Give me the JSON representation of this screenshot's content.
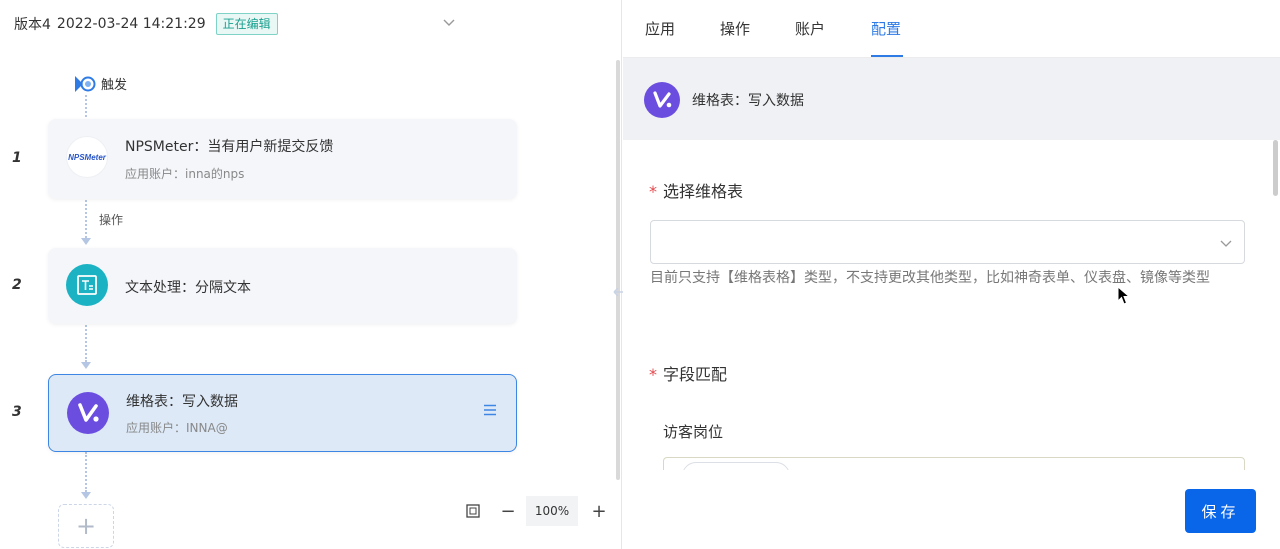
{
  "version": {
    "label": "版本4",
    "timestamp": "2022-03-24 14:21:29",
    "status": "正在编辑"
  },
  "flow": {
    "trigger_label": "触发",
    "operation_label": "操作",
    "steps": [
      {
        "number": "1",
        "title": "NPSMeter：当有用户新提交反馈",
        "subtitle": "应用账户：inna的nps",
        "logo_text": "NPSMeter"
      },
      {
        "number": "2",
        "title": "文本处理：分隔文本",
        "subtitle": ""
      },
      {
        "number": "3",
        "title": "维格表：写入数据",
        "subtitle": "应用账户：INNA@"
      }
    ],
    "add_symbol": "+"
  },
  "zoom": {
    "minus": "−",
    "value": "100%",
    "plus": "+"
  },
  "tabs": [
    {
      "label": "应用"
    },
    {
      "label": "操作"
    },
    {
      "label": "账户"
    },
    {
      "label": "配置",
      "active": true
    }
  ],
  "config": {
    "app_title": "维格表：写入数据",
    "select_sheet_label": "选择维格表",
    "select_sheet_value": "",
    "hint": "目前只支持【维格表格】类型，不支持更改其他类型，比如神奇表单、仪表盘、镜像等类型",
    "field_match_label": "字段匹配",
    "field_name": "访客岗位",
    "required_mark": "*",
    "save_label": "保存"
  },
  "colors": {
    "accent": "#2f7be5",
    "save_button": "#0a66e8",
    "badge_text": "#1aa08f",
    "vika_logo": "#6b4ee0",
    "text_tool": "#1bb3c4",
    "required": "#e5484d"
  }
}
